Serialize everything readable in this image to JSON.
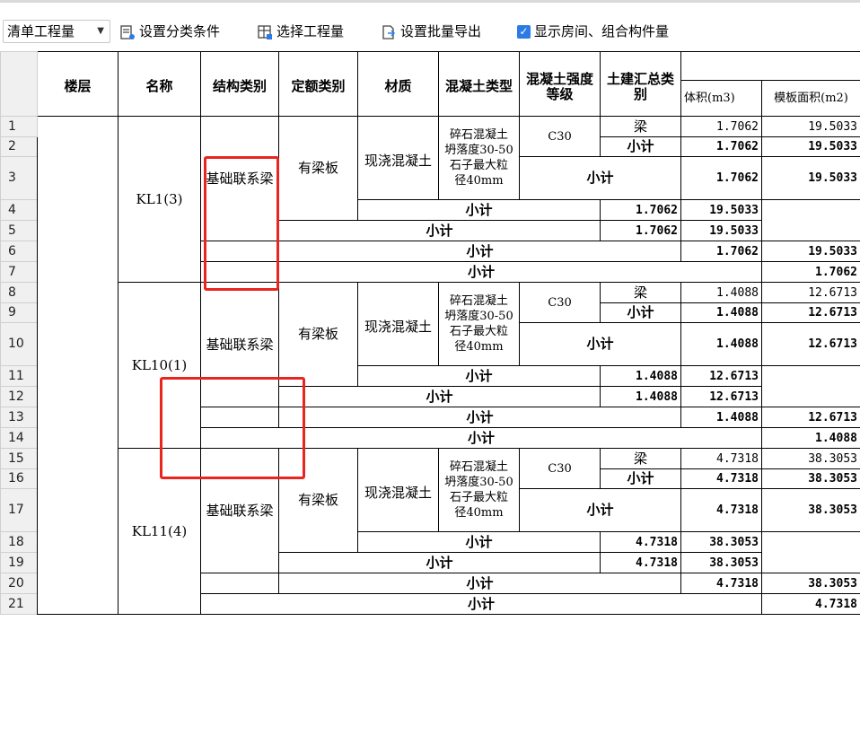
{
  "toolbar": {
    "combo_value": "清单工程量",
    "set_category_label": "设置分类条件",
    "select_quantity_label": "选择工程量",
    "batch_export_label": "设置批量导出",
    "show_rooms_label": "显示房间、组合构件量"
  },
  "columns": {
    "floor": "楼层",
    "name": "名称",
    "struct_type": "结构类别",
    "quota_type": "定额类别",
    "material": "材质",
    "concrete_type": "混凝土类型",
    "concrete_grade": "混凝土强度等级",
    "summary_type": "土建汇总类别",
    "volume": "体积(m3)",
    "formwork": "模板面积(m2)"
  },
  "groups": [
    {
      "rows": [
        "1",
        "2",
        "3",
        "4",
        "5",
        "6",
        "7"
      ],
      "name": "KL1(3)",
      "struct_type": "基础联系梁",
      "quota_type": "有梁板",
      "material": "现浇混凝土",
      "concrete_type": "碎石混凝土 坍落度30-50 石子最大粒径40mm",
      "grade": "C30",
      "summary_type": "梁",
      "subtotal": "小计",
      "volume": "1.7062",
      "formwork": "19.5033"
    },
    {
      "rows": [
        "8",
        "9",
        "10",
        "11",
        "12",
        "13",
        "14"
      ],
      "name": "KL10(1)",
      "struct_type": "基础联系梁",
      "quota_type": "有梁板",
      "material": "现浇混凝土",
      "concrete_type": "碎石混凝土 坍落度30-50 石子最大粒径40mm",
      "grade": "C30",
      "summary_type": "梁",
      "subtotal": "小计",
      "volume": "1.4088",
      "formwork": "12.6713"
    },
    {
      "rows": [
        "15",
        "16",
        "17",
        "18",
        "19",
        "20",
        "21"
      ],
      "name": "KL11(4)",
      "struct_type": "基础联系梁",
      "quota_type": "有梁板",
      "material": "现浇混凝土",
      "concrete_type": "碎石混凝土 坍落度30-50 石子最大粒径40mm",
      "grade": "C30",
      "summary_type": "梁",
      "subtotal": "小计",
      "volume": "4.7318",
      "formwork": "38.3053"
    }
  ]
}
